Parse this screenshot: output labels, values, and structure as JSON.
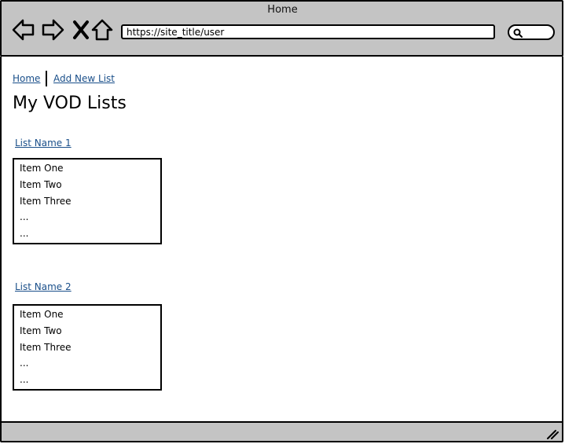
{
  "window": {
    "title": "Home"
  },
  "address_bar": {
    "url": "https://site_title/user"
  },
  "breadcrumb": {
    "home": "Home",
    "add_new_list": "Add New List"
  },
  "page": {
    "title": "My VOD Lists"
  },
  "lists": [
    {
      "name": "List Name 1",
      "items": [
        "Item One",
        "Item Two",
        "Item Three",
        "...",
        "..."
      ]
    },
    {
      "name": "List Name 2",
      "items": [
        "Item One",
        "Item Two",
        "Item Three",
        "...",
        "..."
      ]
    }
  ],
  "icons": {
    "back": "back-arrow-icon",
    "forward": "forward-arrow-icon",
    "stop": "close-icon",
    "home": "home-icon",
    "search": "search-icon",
    "resize": "resize-grip-icon"
  },
  "colors": {
    "chrome": "#c4c4c4",
    "link": "#1a4f8a"
  }
}
